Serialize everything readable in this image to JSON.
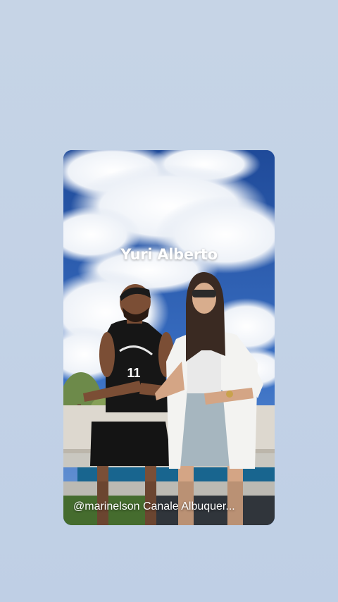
{
  "story": {
    "name_sticker": "Yuri Alberto",
    "credit_text": "@marinelson Canale Albuquer..."
  },
  "colors": {
    "background": "#c4d3e6",
    "sky": "#2f5fb0",
    "text": "#ffffff"
  }
}
